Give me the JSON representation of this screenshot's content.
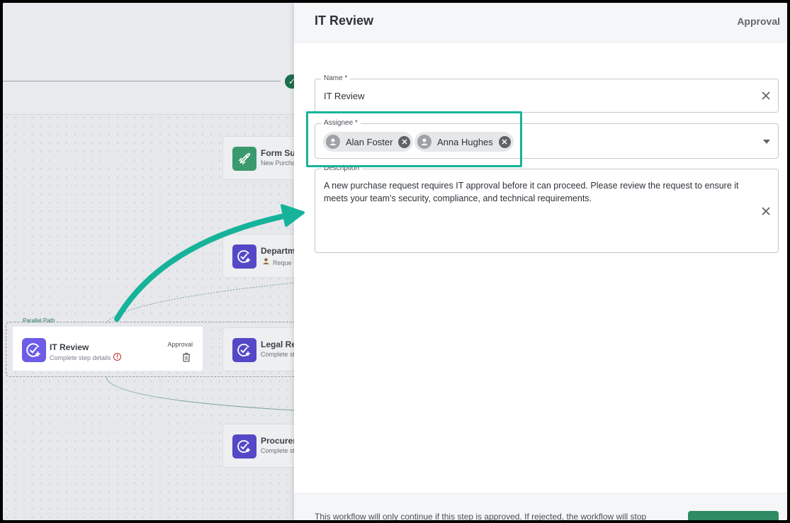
{
  "canvas": {
    "nodes": [
      {
        "title": "Form Su",
        "subtitle": "New Purcha",
        "icon": "rocket-icon"
      },
      {
        "title": "Departm",
        "subtitle": "Reque",
        "icon": "check-plus-icon"
      },
      {
        "title": "Legal Re",
        "subtitle": "Complete st",
        "icon": "check-plus-icon"
      },
      {
        "title": "Procurer",
        "subtitle": "Complete st",
        "icon": "check-plus-icon"
      }
    ],
    "parallel_label": "Parallel Path",
    "selected_card": {
      "title": "IT Review",
      "subtitle": "Complete step details",
      "badge": "Approval",
      "warning": "!"
    }
  },
  "panel": {
    "title": "IT Review",
    "type": "Approval",
    "name_field": {
      "label": "Name *",
      "value": "IT Review"
    },
    "assignee_field": {
      "label": "Assignee *",
      "chips": [
        {
          "label": "Alan Foster"
        },
        {
          "label": "Anna Hughes"
        }
      ]
    },
    "description_field": {
      "label": "Description",
      "value": "A new purchase request requires IT approval before it can proceed. Please review the request to ensure it meets your team's security, compliance, and technical requirements."
    },
    "footer_text": "This workflow will only continue if this step is approved. If rejected, the workflow will stop"
  },
  "colors": {
    "highlight": "#16b39a",
    "arrow": "#16b39a",
    "accent_purple": "#6c5ce7",
    "accent_green": "#2e8b62"
  }
}
